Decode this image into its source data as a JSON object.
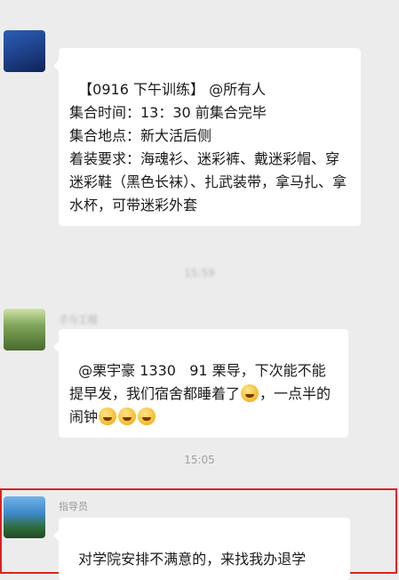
{
  "messages": [
    {
      "sender": "",
      "text": "【0916 下午训练】 @所有人\n集合时间：13：30 前集合完毕\n集合地点：新大活后侧\n着装要求：海魂衫、迷彩裤、戴迷彩帽、穿迷彩鞋（黑色长袜）、扎武装带，拿马扎、拿水杯，可带迷彩外套"
    },
    {
      "sender": "子与工程",
      "text_part1": "@栗宇豪 1330   91 栗导，下次能不能提早发，我们宿舍都睡着了",
      "text_part2": "，一点半的闹钟"
    },
    {
      "sender": "指导员",
      "text": "对学院安排不满意的，来找我办退学"
    }
  ],
  "timestamps": {
    "first": "15:59",
    "second": "15:05"
  },
  "colors": {
    "background": "#ececec",
    "bubble": "#ffffff",
    "highlight": "#e0201e"
  }
}
